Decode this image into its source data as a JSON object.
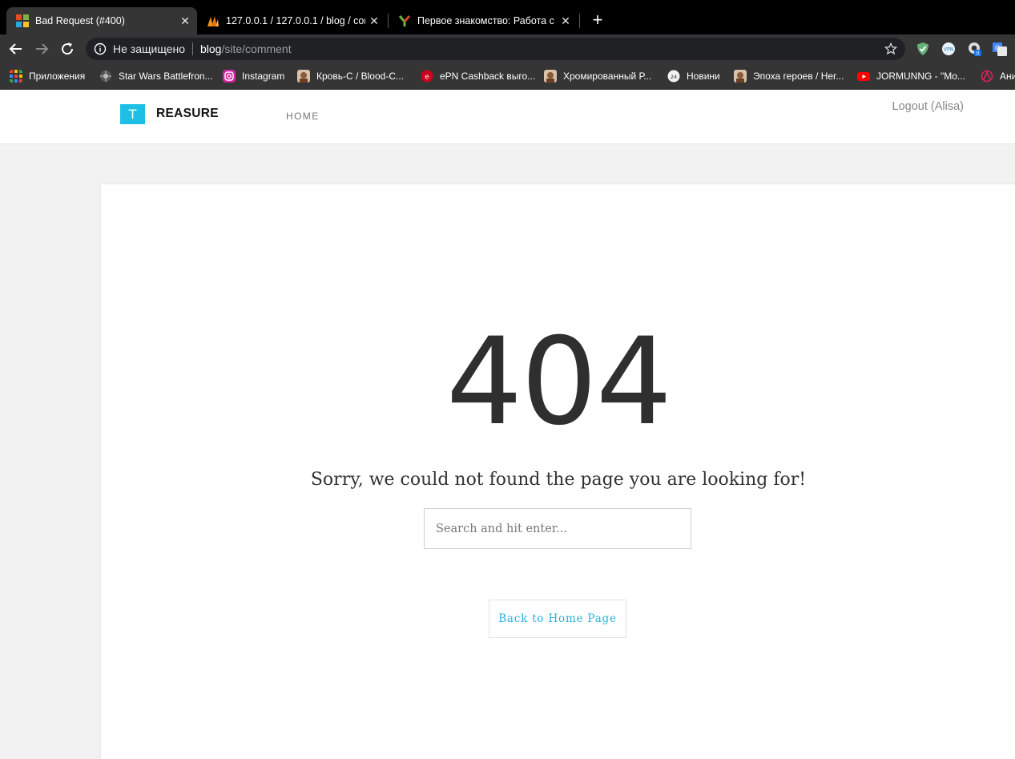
{
  "browser": {
    "tabs": [
      {
        "title": "Bad Request (#400)",
        "active": true
      },
      {
        "title": "127.0.0.1 / 127.0.0.1 / blog / com",
        "active": false
      },
      {
        "title": "Первое знакомство: Работа с ф",
        "active": false
      }
    ],
    "address": {
      "security_label": "Не защищено",
      "host": "blog",
      "path": "/site/comment"
    },
    "bookmarks": [
      {
        "label": "Приложения",
        "icon": "apps-grid-icon"
      },
      {
        "label": "Star Wars Battlefron...",
        "icon": "star-wars-icon"
      },
      {
        "label": "Instagram",
        "icon": "instagram-icon"
      },
      {
        "label": "Кровь-С / Blood-C...",
        "icon": "anime-avatar-icon"
      },
      {
        "label": "ePN Cashback выго...",
        "icon": "epn-icon"
      },
      {
        "label": "Хромированный Р...",
        "icon": "anime-avatar-icon"
      },
      {
        "label": "Новини",
        "icon": "news-24-icon"
      },
      {
        "label": "Эпоха героев / Her...",
        "icon": "anime-avatar-icon"
      },
      {
        "label": "JORMUNNG - \"Mo...",
        "icon": "youtube-icon"
      },
      {
        "label": "Ани",
        "icon": "anime-logo-icon"
      }
    ]
  },
  "site": {
    "logo_letter": "T",
    "logo_text": "REASURE",
    "nav_home": "HOME",
    "logout": "Logout (Alisa)"
  },
  "error": {
    "code": "404",
    "message": "Sorry, we could not found the page you are looking for!",
    "search_placeholder": "Search and hit enter...",
    "back_button": "Back to Home Page"
  },
  "colors": {
    "accent": "#1dbfe5",
    "link": "#27b1dc",
    "page_bg": "#f2f2f2"
  }
}
